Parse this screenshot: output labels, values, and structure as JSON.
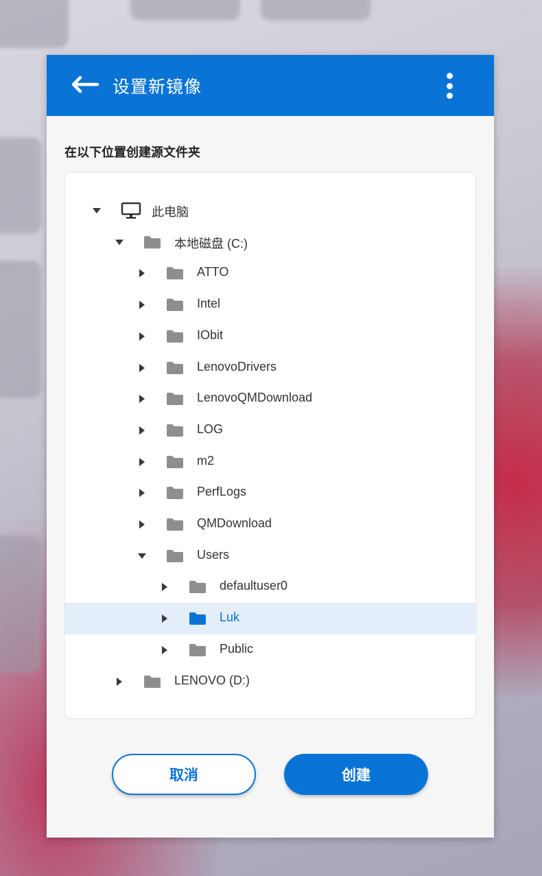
{
  "header": {
    "title": "设置新镜像",
    "back_icon": "arrow-left-icon",
    "more_icon": "more-vertical-icon"
  },
  "subtitle": "在以下位置创建源文件夹",
  "tree": {
    "nodes": [
      {
        "label": "此电脑",
        "icon": "monitor-icon",
        "expanded": true
      },
      {
        "label": "本地磁盘 (C:)",
        "icon": "folder-icon",
        "expanded": true
      },
      {
        "label": "ATTO",
        "icon": "folder-icon",
        "expanded": false
      },
      {
        "label": "Intel",
        "icon": "folder-icon",
        "expanded": false
      },
      {
        "label": "IObit",
        "icon": "folder-icon",
        "expanded": false
      },
      {
        "label": "LenovoDrivers",
        "icon": "folder-icon",
        "expanded": false
      },
      {
        "label": "LenovoQMDownload",
        "icon": "folder-icon",
        "expanded": false
      },
      {
        "label": "LOG",
        "icon": "folder-icon",
        "expanded": false
      },
      {
        "label": "m2",
        "icon": "folder-icon",
        "expanded": false
      },
      {
        "label": "PerfLogs",
        "icon": "folder-icon",
        "expanded": false
      },
      {
        "label": "QMDownload",
        "icon": "folder-icon",
        "expanded": false
      },
      {
        "label": "Users",
        "icon": "folder-icon",
        "expanded": true
      },
      {
        "label": "defaultuser0",
        "icon": "folder-icon",
        "expanded": false
      },
      {
        "label": "Luk",
        "icon": "folder-icon",
        "expanded": false,
        "selected": true
      },
      {
        "label": "Public",
        "icon": "folder-icon",
        "expanded": false
      },
      {
        "label": "LENOVO (D:)",
        "icon": "folder-icon",
        "expanded": false
      }
    ]
  },
  "buttons": {
    "cancel": "取消",
    "create": "创建"
  },
  "colors": {
    "accent": "#0a74d6",
    "selected_bg": "#e3eefa",
    "folder": "#8e8e8e"
  }
}
